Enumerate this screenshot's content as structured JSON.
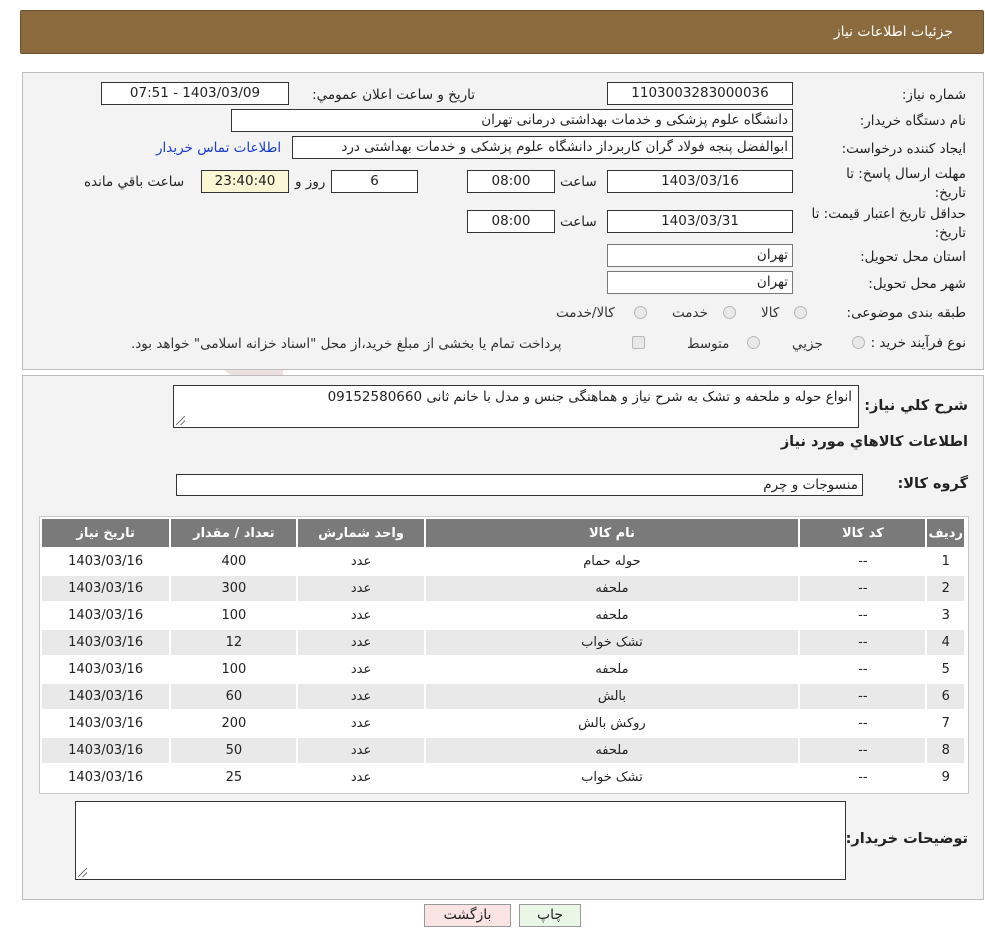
{
  "header": {
    "title": "جزئیات اطلاعات نیاز"
  },
  "form": {
    "need_number_label": "شماره نیاز:",
    "need_number": "1103003283000036",
    "announce_datetime_label": "تاریخ و ساعت اعلان عمومي:",
    "announce_datetime": "1403/03/09 - 07:51",
    "buyer_org_label": "نام دستگاه خریدار:",
    "buyer_org": "دانشگاه علوم پزشکی و خدمات بهداشتی درمانی تهران",
    "requester_label": "ایجاد کننده درخواست:",
    "requester": "ابوالفضل  پنجه فولاد گران  کاربرداز دانشگاه علوم پزشکی و خدمات بهداشتی درد",
    "buyer_contact_link": "اطلاعات تماس خریدار",
    "deadline_label_1": "مهلت ارسال پاسخ: تا",
    "deadline_label_2": "تاریخ:",
    "deadline_date": "1403/03/16",
    "time_label": "ساعت",
    "deadline_time": "08:00",
    "days_value": "6",
    "days_label": "روز و",
    "remaining_time": "23:40:40",
    "remaining_label": "ساعت باقي مانده",
    "validity_label_1": "حداقل تاریخ اعتبار قیمت: تا",
    "validity_label_2": "تاریخ:",
    "validity_date": "1403/03/31",
    "validity_time_label": "ساعت",
    "validity_time": "08:00",
    "province_label": "استان محل تحویل:",
    "province": "تهران",
    "city_label": "شهر محل تحویل:",
    "city": "تهران",
    "category_label": "طبقه بندی موضوعی:",
    "category_options": [
      "کالا",
      "خدمت",
      "کالا/خدمت"
    ],
    "process_label": "نوع فرآیند خرید :",
    "process_options": [
      "جزیي",
      "متوسط"
    ],
    "process_note": "پرداخت تمام یا بخشی از مبلغ خرید،از محل \"اسناد خزانه اسلامی\" خواهد بود."
  },
  "details": {
    "summary_label": "شرح کلي نیاز:",
    "summary": "انواع حوله و ملحفه و تشک به شرح نیاز و هماهنگی جنس و مدل با خانم ثانی 09152580660",
    "goods_info_title": "اطلاعات کالاهاي مورد نیاز",
    "goods_group_label": "گروه کالا:",
    "goods_group": "منسوجات و چرم",
    "table": {
      "headers": [
        "ردیف",
        "کد کالا",
        "نام کالا",
        "واحد شمارش",
        "تعداد / مقدار",
        "تاریخ نیاز"
      ],
      "rows": [
        [
          "1",
          "--",
          "حوله حمام",
          "عدد",
          "400",
          "1403/03/16"
        ],
        [
          "2",
          "--",
          "ملحفه",
          "عدد",
          "300",
          "1403/03/16"
        ],
        [
          "3",
          "--",
          "ملحفه",
          "عدد",
          "100",
          "1403/03/16"
        ],
        [
          "4",
          "--",
          "تشک خواب",
          "عدد",
          "12",
          "1403/03/16"
        ],
        [
          "5",
          "--",
          "ملحفه",
          "عدد",
          "100",
          "1403/03/16"
        ],
        [
          "6",
          "--",
          "بالش",
          "عدد",
          "60",
          "1403/03/16"
        ],
        [
          "7",
          "--",
          "روکش بالش",
          "عدد",
          "200",
          "1403/03/16"
        ],
        [
          "8",
          "--",
          "ملحفه",
          "عدد",
          "50",
          "1403/03/16"
        ],
        [
          "9",
          "--",
          "تشک خواب",
          "عدد",
          "25",
          "1403/03/16"
        ]
      ]
    },
    "buyer_notes_label": "توضیحات خریدار:",
    "buyer_notes": ""
  },
  "buttons": {
    "print": "چاپ",
    "back": "بازگشت"
  },
  "watermark": {
    "text": "AriaTender.neT"
  },
  "colors": {
    "header": "#8b6a3e",
    "table_header": "#7a7a7a",
    "link": "#1a3dd1",
    "remaining_bg": "#fbf7d5"
  }
}
